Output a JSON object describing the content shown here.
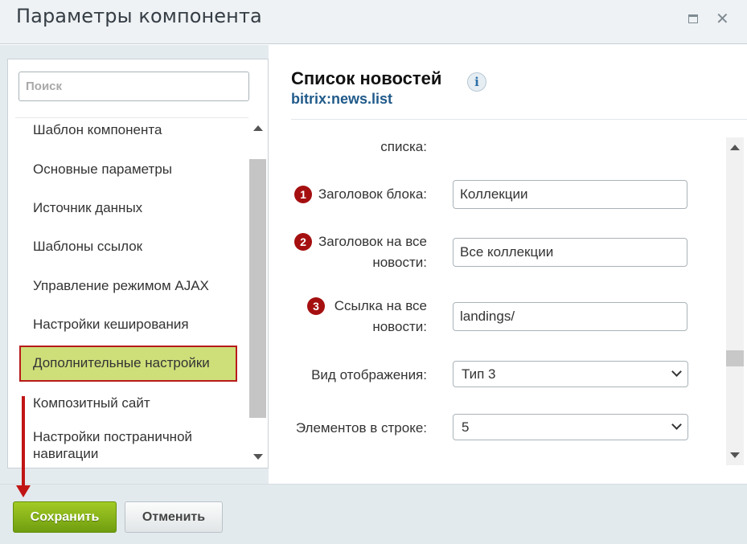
{
  "window": {
    "title": "Параметры компонента",
    "maximize_icon": "maximize-icon",
    "close_icon": "close-icon"
  },
  "search": {
    "placeholder": "Поиск",
    "value": ""
  },
  "sidebar": {
    "items": [
      {
        "label": "Шаблон компонента"
      },
      {
        "label": "Основные параметры"
      },
      {
        "label": "Источник данных"
      },
      {
        "label": "Шаблоны ссылок"
      },
      {
        "label": "Управление режимом AJAX"
      },
      {
        "label": "Настройки кеширования"
      },
      {
        "label": "Дополнительные настройки",
        "active": true
      },
      {
        "label": "Композитный сайт"
      },
      {
        "label": "Настройки постраничной навигации"
      }
    ]
  },
  "component": {
    "title": "Список новостей",
    "code": "bitrix:news.list",
    "info_icon": "info-icon"
  },
  "form": {
    "truncated_label": "списка:",
    "fields": [
      {
        "badge": "1",
        "label": "Заголовок блока:",
        "value": "Коллекции"
      },
      {
        "badge": "2",
        "label_line1": "Заголовок на все",
        "label_line2": "новости:",
        "value": "Все коллекции"
      },
      {
        "badge": "3",
        "label_line1": "Ссылка на все",
        "label_line2": "новости:",
        "value": "landings/"
      }
    ],
    "selects": [
      {
        "label": "Вид отображения:",
        "value": "Тип 3"
      },
      {
        "label": "Элементов в строке:",
        "value": "5"
      }
    ]
  },
  "footer": {
    "save_label": "Сохранить",
    "cancel_label": "Отменить"
  },
  "colors": {
    "accent_green": "#8fbf1f",
    "highlight_border": "#b81a1a",
    "badge_red": "#a50f10",
    "link_blue": "#205a8a"
  }
}
